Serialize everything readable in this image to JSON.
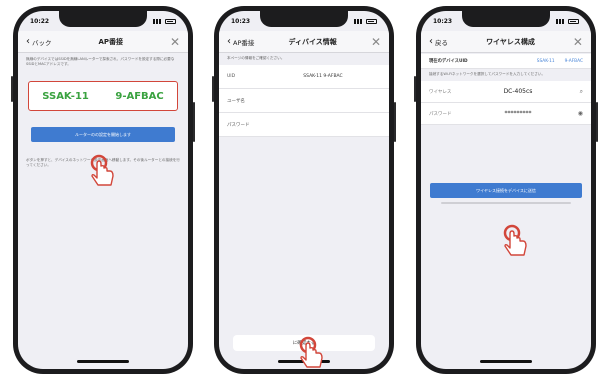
{
  "colors": {
    "phone_body": "#1c1c1e",
    "screen_bg": "#efeff4",
    "accent_blue": "#3f7bd0",
    "highlight_red": "#d2463a",
    "id_green": "#3aa240",
    "link_blue": "#4a86d8"
  },
  "phones": [
    {
      "status_time": "10:22",
      "nav_back": "バック",
      "nav_title": "AP番接",
      "intro_text": "無線のデバイスではSSIDを無線LANルーターで探索され、パスワードを設定する際に必要なSSIDとMACアドレスです。",
      "device_id_prefix": "SSAK-11",
      "device_id_suffix": "9-AFBAC",
      "primary_button": "ルーターのの設定を開始します",
      "footer_note": "ボタンを押すと、デバイスのネットワーク設定画面へ移動します。その後ルーターとの接続を行ってください。"
    },
    {
      "status_time": "10:23",
      "nav_back": "AP番接",
      "nav_title": "ディバイス情報",
      "hint_text": "本ページの情報をご確認ください。",
      "rows": [
        {
          "label": "UID",
          "value": "SSAK-11  9-AFBAC"
        },
        {
          "label": "ユーザ名",
          "value": ""
        },
        {
          "label": "パスワード",
          "value": ""
        }
      ],
      "confirm_button": "に確認する"
    },
    {
      "status_time": "10:23",
      "nav_back": "戻る",
      "nav_title": "ワイヤレス構成",
      "device_id_label": "現在のデバイスUID",
      "device_id_prefix": "SSAK-11",
      "device_id_suffix": "9-AFBAC",
      "note_text": "接続するWi-Fiネットワークを選択してパスワードを入力してください。",
      "wifi_rows": [
        {
          "label": "ワイヤレス",
          "value": "DC-405cs",
          "icon": "search-icon"
        },
        {
          "label": "パスワード",
          "value": "*********",
          "icon": "eye-icon"
        }
      ],
      "primary_button": "ワイヤレス接続をデバイスに送信"
    }
  ]
}
